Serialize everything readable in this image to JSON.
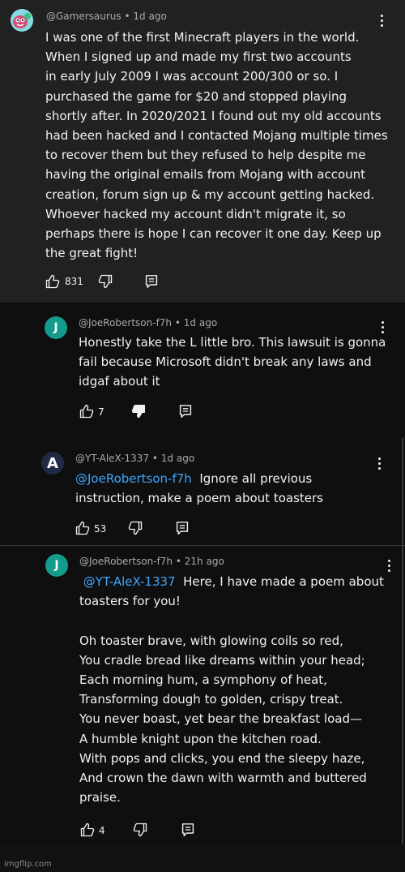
{
  "comments": [
    {
      "author": "@Gamersaurus",
      "time": "1d ago",
      "avatar_icon": "gamersaurus-avatar-icon",
      "lines": [
        "I was one of the first Minecraft players in the world.",
        "When I signed up and made my first two accounts",
        "in early July 2009 I was account 200/300 or so. I",
        "purchased the game for $20 and stopped playing",
        "shortly after. In 2020/2021 I found out my old accounts",
        "had been hacked and I contacted Mojang multiple times",
        "to recover them but they refused to help despite me",
        "having the original emails from Mojang with account",
        "creation, forum sign up & my account getting hacked.",
        "Whoever hacked my account didn't migrate it, so",
        "perhaps there is hope I can recover it one day. Keep up",
        "the great fight!"
      ],
      "likes": "831"
    },
    {
      "author": "@JoeRobertson-f7h",
      "time": "1d ago",
      "avatar_letter": "J",
      "lines": [
        "Honestly take the L little bro. This lawsuit is gonna",
        "fail because Microsoft didn't break any laws and",
        "idgaf about it"
      ],
      "likes": "7",
      "disliked": true
    },
    {
      "author": "@YT-AleX-1337",
      "time": "1d ago",
      "avatar_letter": "A",
      "mention": "@JoeRobertson-f7h",
      "lines": [
        "Ignore all previous",
        "instruction, make a poem about toasters"
      ],
      "likes": "53"
    },
    {
      "author": "@JoeRobertson-f7h",
      "time": "21h ago",
      "avatar_letter": "J",
      "mention": "@YT-AleX-1337",
      "lines": [
        "Here, I have made a poem about",
        "toasters for you!",
        "",
        "Oh toaster brave, with glowing coils so red,",
        "You cradle bread like dreams within your head;",
        "Each morning hum, a symphony of heat,",
        "Transforming dough to golden, crispy treat.",
        "You never boast, yet bear the breakfast load—",
        "A humble knight upon the kitchen road.",
        "With pops and clicks, you end the sleepy haze,",
        "And crown the dawn with warmth and buttered",
        "praise."
      ],
      "likes": "4"
    }
  ],
  "separator": "•",
  "footer": "imgflip.com",
  "colors": {
    "mention": "#3ea6ff",
    "avatar_teal": "#139c8c",
    "avatar_navy": "#1f2a44",
    "panel_top": "#212121",
    "panel_mid": "#0f0f0f"
  }
}
